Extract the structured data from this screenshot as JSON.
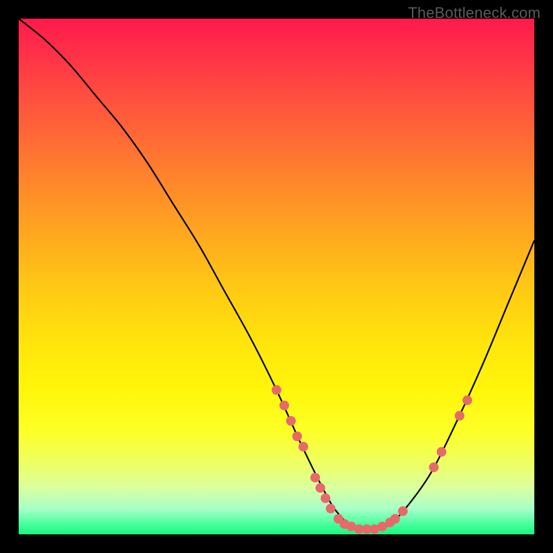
{
  "watermark": "TheBottleneck.com",
  "chart_data": {
    "type": "line",
    "title": "",
    "xlabel": "",
    "ylabel": "",
    "xlim": [
      0,
      100
    ],
    "ylim": [
      0,
      100
    ],
    "grid": false,
    "legend": false,
    "series": [
      {
        "name": "curve",
        "x": [
          0,
          5,
          10,
          15,
          20,
          25,
          30,
          35,
          40,
          45,
          50,
          55,
          60,
          62,
          64,
          66,
          68,
          70,
          72,
          75,
          80,
          85,
          90,
          95,
          100
        ],
        "y": [
          100,
          96,
          91,
          85,
          79,
          72,
          64,
          56,
          47,
          38,
          28,
          17,
          7,
          4,
          2,
          1,
          1,
          1,
          2,
          5,
          12,
          22,
          33,
          45,
          57
        ]
      }
    ],
    "markers": [
      {
        "x": 50.0,
        "y": 28
      },
      {
        "x": 51.5,
        "y": 25
      },
      {
        "x": 52.8,
        "y": 22
      },
      {
        "x": 54.0,
        "y": 19
      },
      {
        "x": 55.2,
        "y": 17
      },
      {
        "x": 57.5,
        "y": 11
      },
      {
        "x": 58.5,
        "y": 9
      },
      {
        "x": 59.5,
        "y": 7
      },
      {
        "x": 60.5,
        "y": 5
      },
      {
        "x": 62.0,
        "y": 3
      },
      {
        "x": 63.2,
        "y": 2
      },
      {
        "x": 64.5,
        "y": 1.5
      },
      {
        "x": 66.0,
        "y": 1
      },
      {
        "x": 67.5,
        "y": 1
      },
      {
        "x": 69.0,
        "y": 1
      },
      {
        "x": 70.5,
        "y": 1.5
      },
      {
        "x": 72.0,
        "y": 2.3
      },
      {
        "x": 73.0,
        "y": 3
      },
      {
        "x": 74.5,
        "y": 4.5
      },
      {
        "x": 80.5,
        "y": 13
      },
      {
        "x": 82.0,
        "y": 16
      },
      {
        "x": 85.5,
        "y": 23
      },
      {
        "x": 87.0,
        "y": 26
      }
    ],
    "marker_radius": 7,
    "colors": {
      "curve": "#000000",
      "markers": "#e66a6a",
      "gradient_top": "#ff1a4a",
      "gradient_bottom": "#19f77e"
    }
  }
}
